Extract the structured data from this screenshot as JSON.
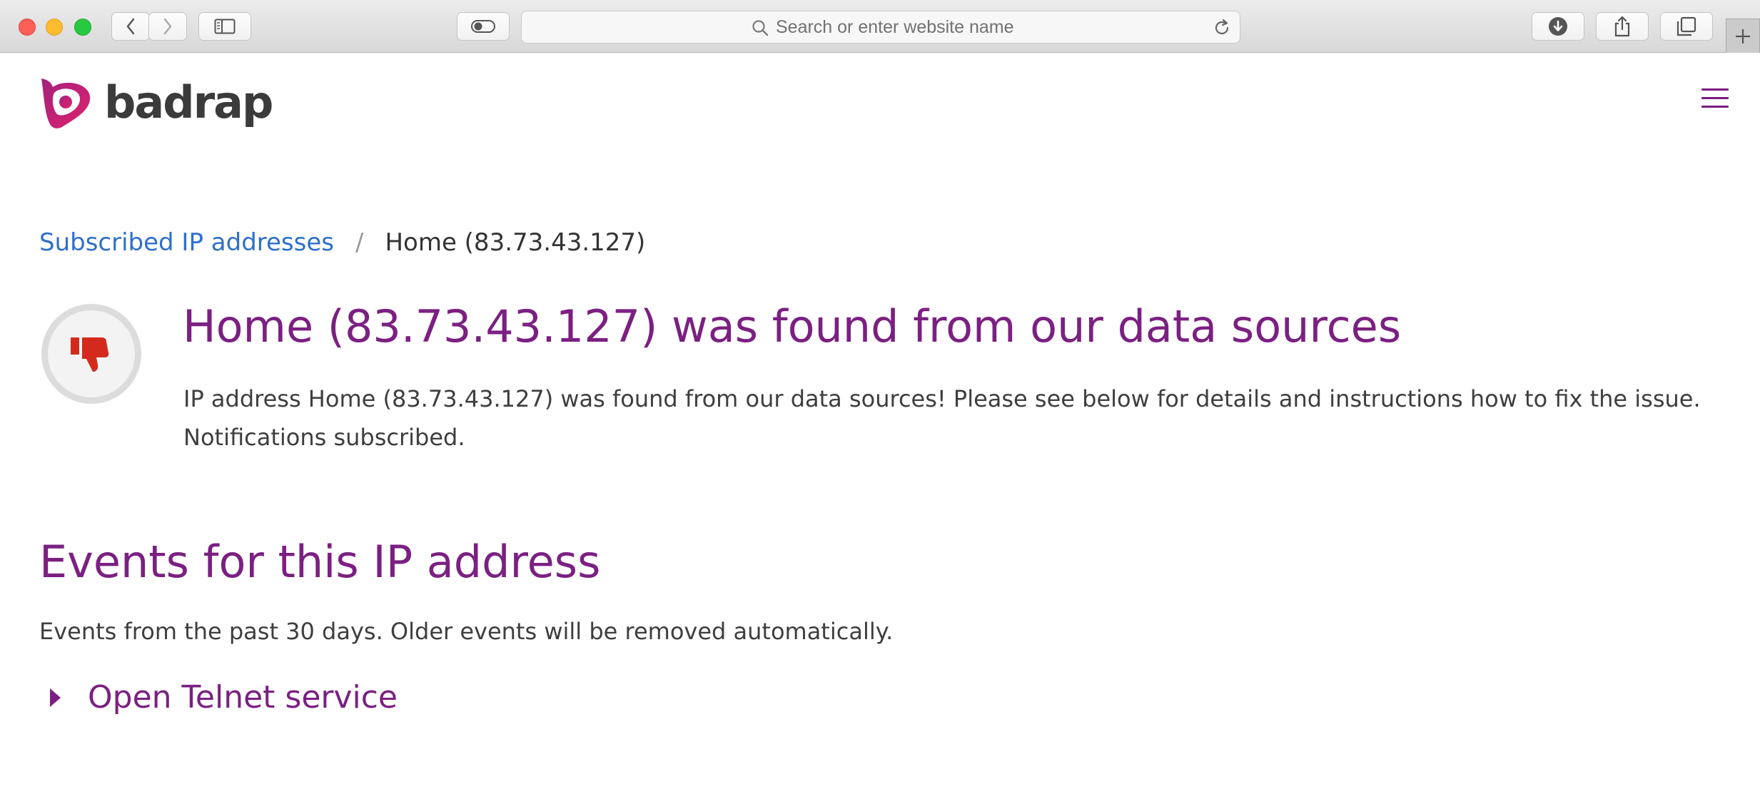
{
  "browser": {
    "address_placeholder": "Search or enter website name"
  },
  "site": {
    "logo_text": "badrap"
  },
  "breadcrumb": {
    "parent_label": "Subscribed IP addresses",
    "separator": "/",
    "current_label": "Home (83.73.43.127)"
  },
  "status": {
    "icon": "thumbs-down-icon",
    "icon_color": "#d42a1e",
    "title": "Home (83.73.43.127) was found from our data sources",
    "description_line1": "IP address Home (83.73.43.127) was found from our data sources! Please see below for details and instructions how to fix the issue.",
    "description_line2": "Notifications subscribed."
  },
  "events": {
    "title": "Events for this IP address",
    "description": "Events from the past 30 days. Older events will be removed automatically.",
    "items": [
      {
        "label": "Open Telnet service",
        "expanded": false
      }
    ]
  },
  "colors": {
    "accent": "#7b2082",
    "link": "#2e6fca",
    "text": "#3e3e3e"
  }
}
